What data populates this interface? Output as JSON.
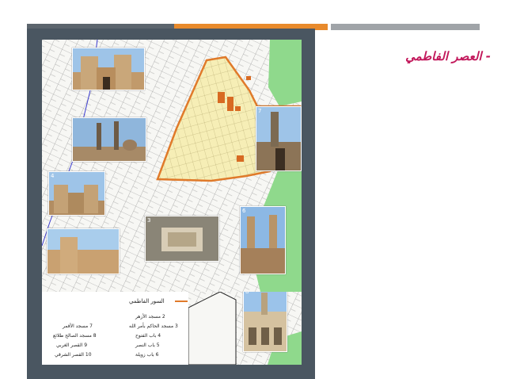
{
  "slide": {
    "title": "- العصر الفاطمي"
  },
  "legend": {
    "title": "السور الفاطمي",
    "left_items": [
      "7 مسجد الأقمر",
      "8 مسجد الصالح طلائع",
      "9 القصر الغربي",
      "10 القصر الشرقي"
    ],
    "right_items": [
      "2 مسجد الأزهر",
      "3 مسجد الحاكم بأمر الله",
      "4 باب الفتوح",
      "5 باب النصر",
      "6 باب زويلة"
    ]
  },
  "photos": [
    {
      "num": ""
    },
    {
      "num": ""
    },
    {
      "num": "4"
    },
    {
      "num": ""
    },
    {
      "num": "3"
    },
    {
      "num": "7"
    },
    {
      "num": "6"
    },
    {
      "num": "8"
    }
  ],
  "colors": {
    "wall": "#e07a2a",
    "city": "#f6eeb6",
    "park": "#8fd98c",
    "frame": "#4a5661",
    "title": "#c2185b",
    "bar_gray": "#a0a4a8",
    "bar_orange": "#e88a2c"
  }
}
